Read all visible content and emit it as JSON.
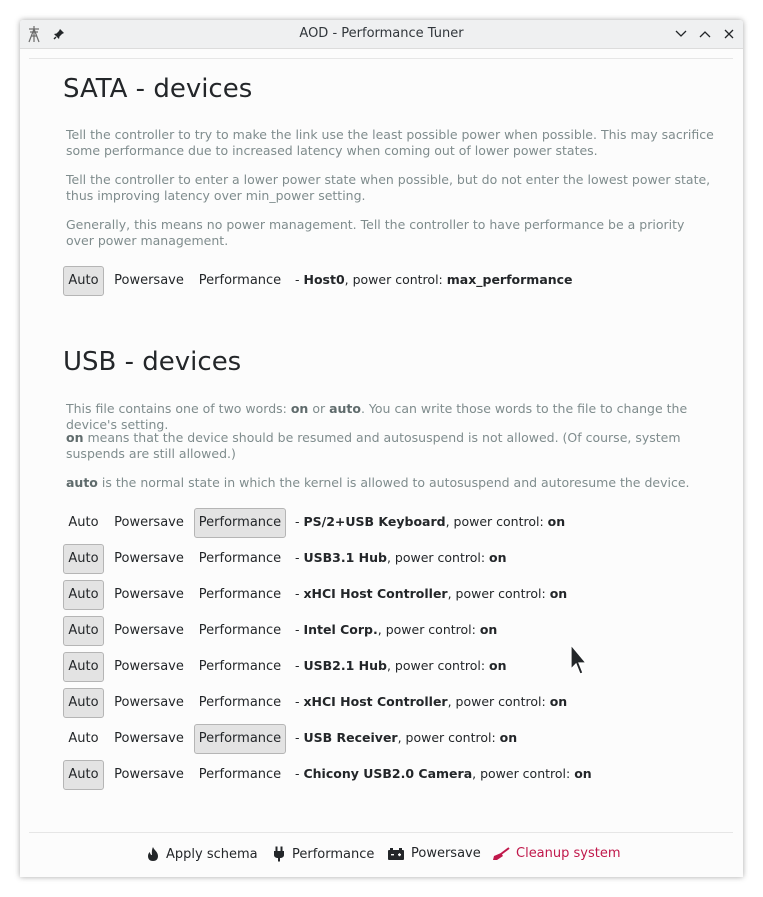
{
  "window": {
    "title": "AOD - Performance Tuner"
  },
  "sata": {
    "heading": "SATA - devices",
    "descriptions": [
      "Tell the controller to try to make the link use the least possible power when possible. This may sacrifice some performance due to increased latency when coming out of lower power states.",
      "Tell the controller to enter a lower power state when possible, but do not enter the lowest power state, thus improving latency over min_power setting.",
      "Generally, this means no power management. Tell the controller to have performance be a priority over power management."
    ],
    "devices": [
      {
        "prefix": "- ",
        "name": "Host0",
        "middle": ", power control: ",
        "value": "max_performance",
        "selected": "auto"
      }
    ]
  },
  "usb": {
    "heading": "USB - devices",
    "desc1": {
      "a": "This file contains one of two words: ",
      "on": "on",
      "b": " or ",
      "auto": "auto",
      "c": ". You can write those words to the file to change the device's setting."
    },
    "desc2": {
      "on": "on",
      "rest": " means that the device should be resumed and autosuspend is not allowed. (Of course, system suspends are still allowed.)"
    },
    "desc3": {
      "auto": "auto",
      "rest": " is the normal state in which the kernel is allowed to autosuspend and autoresume the device."
    },
    "devices": [
      {
        "prefix": "- ",
        "name": "PS/2+USB Keyboard",
        "middle": ", power control: ",
        "value": "on",
        "selected": "performance"
      },
      {
        "prefix": "- ",
        "name": "USB3.1 Hub",
        "middle": ", power control: ",
        "value": "on",
        "selected": "auto"
      },
      {
        "prefix": "- ",
        "name": "xHCI Host Controller",
        "middle": ", power control: ",
        "value": "on",
        "selected": "auto"
      },
      {
        "prefix": "- ",
        "name": "Intel Corp.",
        "middle": ", power control: ",
        "value": "on",
        "selected": "auto"
      },
      {
        "prefix": "- ",
        "name": "USB2.1 Hub",
        "middle": ", power control: ",
        "value": "on",
        "selected": "auto"
      },
      {
        "prefix": "- ",
        "name": "xHCI Host Controller",
        "middle": ", power control: ",
        "value": "on",
        "selected": "auto"
      },
      {
        "prefix": "- ",
        "name": "USB Receiver",
        "middle": ", power control: ",
        "value": "on",
        "selected": "performance"
      },
      {
        "prefix": "- ",
        "name": "Chicony USB2.0 Camera",
        "middle": ", power control: ",
        "value": "on",
        "selected": "auto"
      }
    ]
  },
  "options": {
    "auto": "Auto",
    "powersave": "Powersave",
    "performance": "Performance"
  },
  "footer": {
    "apply": "Apply schema",
    "performance": "Performance",
    "powersave": "Powersave",
    "cleanup": "Cleanup system"
  },
  "colors": {
    "selected_bg": "#e3e3e3",
    "desc_text": "#7f8c8d",
    "danger": "#c0184b"
  },
  "icons": {
    "app": "power-tower-icon",
    "pin": "pin-icon",
    "minimize": "chevron-down-icon",
    "maximize": "chevron-up-icon",
    "close": "close-icon",
    "apply": "flame-icon",
    "performance": "plug-icon",
    "powersave": "battery-icon",
    "cleanup": "broom-icon"
  }
}
